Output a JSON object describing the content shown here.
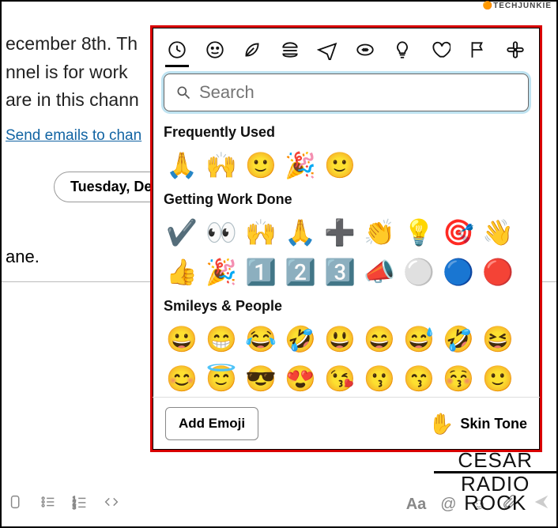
{
  "watermark_site": "TECHJUNKIE",
  "background": {
    "line1": "ecember 8th. Th",
    "line2": "nnel is for work",
    "line3": "are in this chann",
    "link": "Send emails to chan",
    "date_pill": "Tuesday, De",
    "line4": "ane."
  },
  "picker": {
    "tabs": [
      {
        "name": "recent",
        "icon": "clock",
        "active": true
      },
      {
        "name": "smileys",
        "icon": "smile",
        "active": false
      },
      {
        "name": "nature",
        "icon": "leaf",
        "active": false
      },
      {
        "name": "food",
        "icon": "burger",
        "active": false
      },
      {
        "name": "travel",
        "icon": "plane",
        "active": false
      },
      {
        "name": "activities",
        "icon": "football",
        "active": false
      },
      {
        "name": "objects",
        "icon": "bulb",
        "active": false
      },
      {
        "name": "symbols",
        "icon": "heart",
        "active": false
      },
      {
        "name": "flags",
        "icon": "flag",
        "active": false
      },
      {
        "name": "custom",
        "icon": "slack",
        "active": false
      }
    ],
    "search_placeholder": "Search",
    "sections": [
      {
        "title": "Frequently Used",
        "emojis": [
          "🙏",
          "🙌",
          "🙂",
          "🎉",
          "🙂"
        ]
      },
      {
        "title": "Getting Work Done",
        "emojis": [
          "✔️",
          "👀",
          "🙌",
          "🙏",
          "➕",
          "👏",
          "💡",
          "🎯",
          "👋",
          "👍",
          "🎉",
          "1️⃣",
          "2️⃣",
          "3️⃣",
          "📣",
          "⚪",
          "🔵",
          "🔴"
        ]
      },
      {
        "title": "Smileys & People",
        "emojis": [
          "😀",
          "😁",
          "😂",
          "🤣",
          "😃",
          "😄",
          "😅",
          "🤣",
          "😆",
          "😊",
          "😇",
          "😎",
          "😍",
          "😘",
          "😗",
          "😙",
          "😚",
          "🙂"
        ]
      }
    ],
    "footer": {
      "add_label": "Add Emoji",
      "skin_label": "Skin Tone",
      "skin_swatch": "✋"
    }
  },
  "toolbar": {
    "format": "Aa"
  },
  "brand": {
    "l1": "CESAR",
    "l2": "RADIO",
    "l3": "ROCK"
  }
}
